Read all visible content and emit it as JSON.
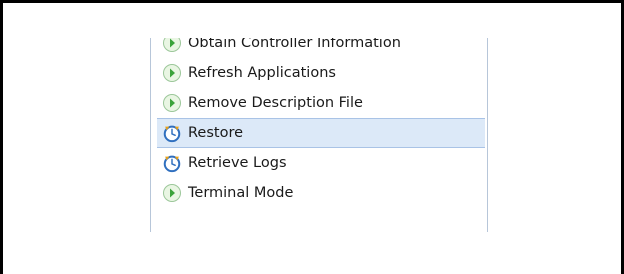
{
  "menu": {
    "items": [
      {
        "label": "Obtain Controller Information",
        "icon": "green-arrow-icon"
      },
      {
        "label": "Refresh Applications",
        "icon": "green-arrow-icon"
      },
      {
        "label": "Remove Description File",
        "icon": "green-arrow-icon"
      },
      {
        "label": "Restore",
        "icon": "clock-refresh-icon",
        "selected": true
      },
      {
        "label": "Retrieve Logs",
        "icon": "clock-refresh-icon"
      },
      {
        "label": "Terminal Mode",
        "icon": "green-arrow-icon"
      }
    ]
  },
  "colors": {
    "selection_bg": "#dce9f8",
    "selection_border": "#a9c3e6",
    "arrow_green": "#3aa33a",
    "clock_blue": "#2f6fbf"
  }
}
